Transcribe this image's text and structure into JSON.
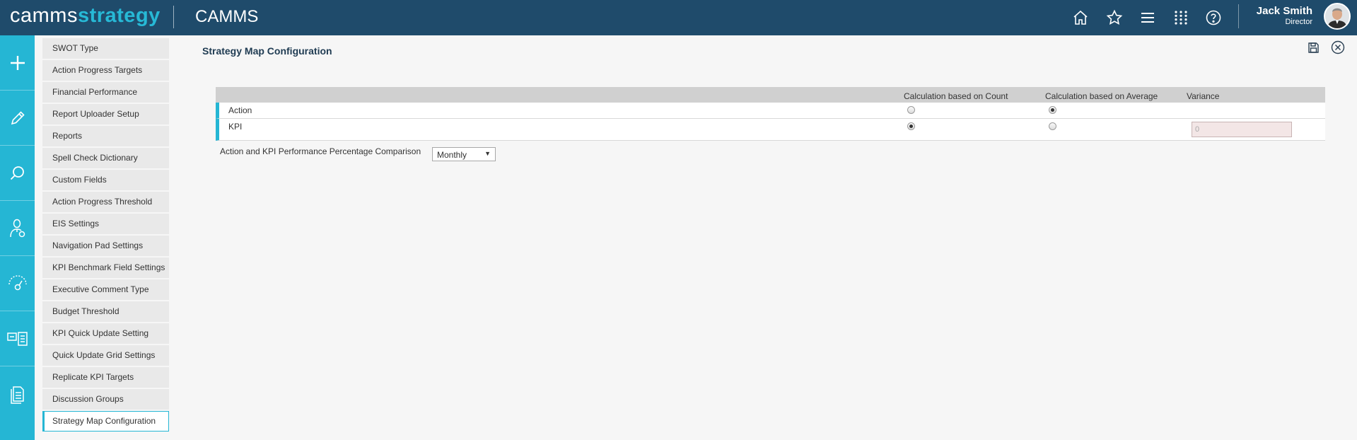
{
  "header": {
    "logo_part1": "camms",
    "logo_part2": "strategy",
    "app_title": "CAMMS",
    "user_name": "Jack Smith",
    "user_role": "Director",
    "icons": [
      "home-icon",
      "star-icon",
      "menu-icon",
      "apps-grid-icon",
      "help-icon"
    ]
  },
  "rail": {
    "icons": [
      "plus-icon",
      "pencil-icon",
      "search-icon",
      "user-icon",
      "gauge-icon",
      "cards-icon",
      "document-icon"
    ]
  },
  "submenu": {
    "items": [
      {
        "label": "SWOT Type"
      },
      {
        "label": "Action Progress Targets"
      },
      {
        "label": "Financial Performance"
      },
      {
        "label": "Report Uploader Setup"
      },
      {
        "label": "Reports"
      },
      {
        "label": "Spell Check Dictionary"
      },
      {
        "label": "Custom Fields"
      },
      {
        "label": "Action Progress Threshold"
      },
      {
        "label": "EIS Settings"
      },
      {
        "label": "Navigation Pad Settings"
      },
      {
        "label": "KPI Benchmark Field Settings"
      },
      {
        "label": "Executive Comment Type"
      },
      {
        "label": "Budget Threshold"
      },
      {
        "label": "KPI Quick Update Setting"
      },
      {
        "label": "Quick Update Grid Settings"
      },
      {
        "label": "Replicate KPI Targets"
      },
      {
        "label": "Discussion Groups"
      },
      {
        "label": "Strategy Map Configuration",
        "active": true
      }
    ]
  },
  "main": {
    "title": "Strategy Map Configuration",
    "grid": {
      "columns": [
        "Calculation based on Count",
        "Calculation based on Average",
        "Variance"
      ],
      "rows": [
        {
          "label": "Action",
          "count_selected": false,
          "average_selected": true
        },
        {
          "label": "KPI",
          "count_selected": true,
          "average_selected": false,
          "variance_value": "0"
        }
      ]
    },
    "comparison": {
      "label": "Action and KPI Performance Percentage Comparison",
      "selected": "Monthly"
    }
  },
  "colors": {
    "header_bg": "#1f4b6b",
    "accent": "#25b6d4",
    "logo_accent": "#27b9d6"
  }
}
